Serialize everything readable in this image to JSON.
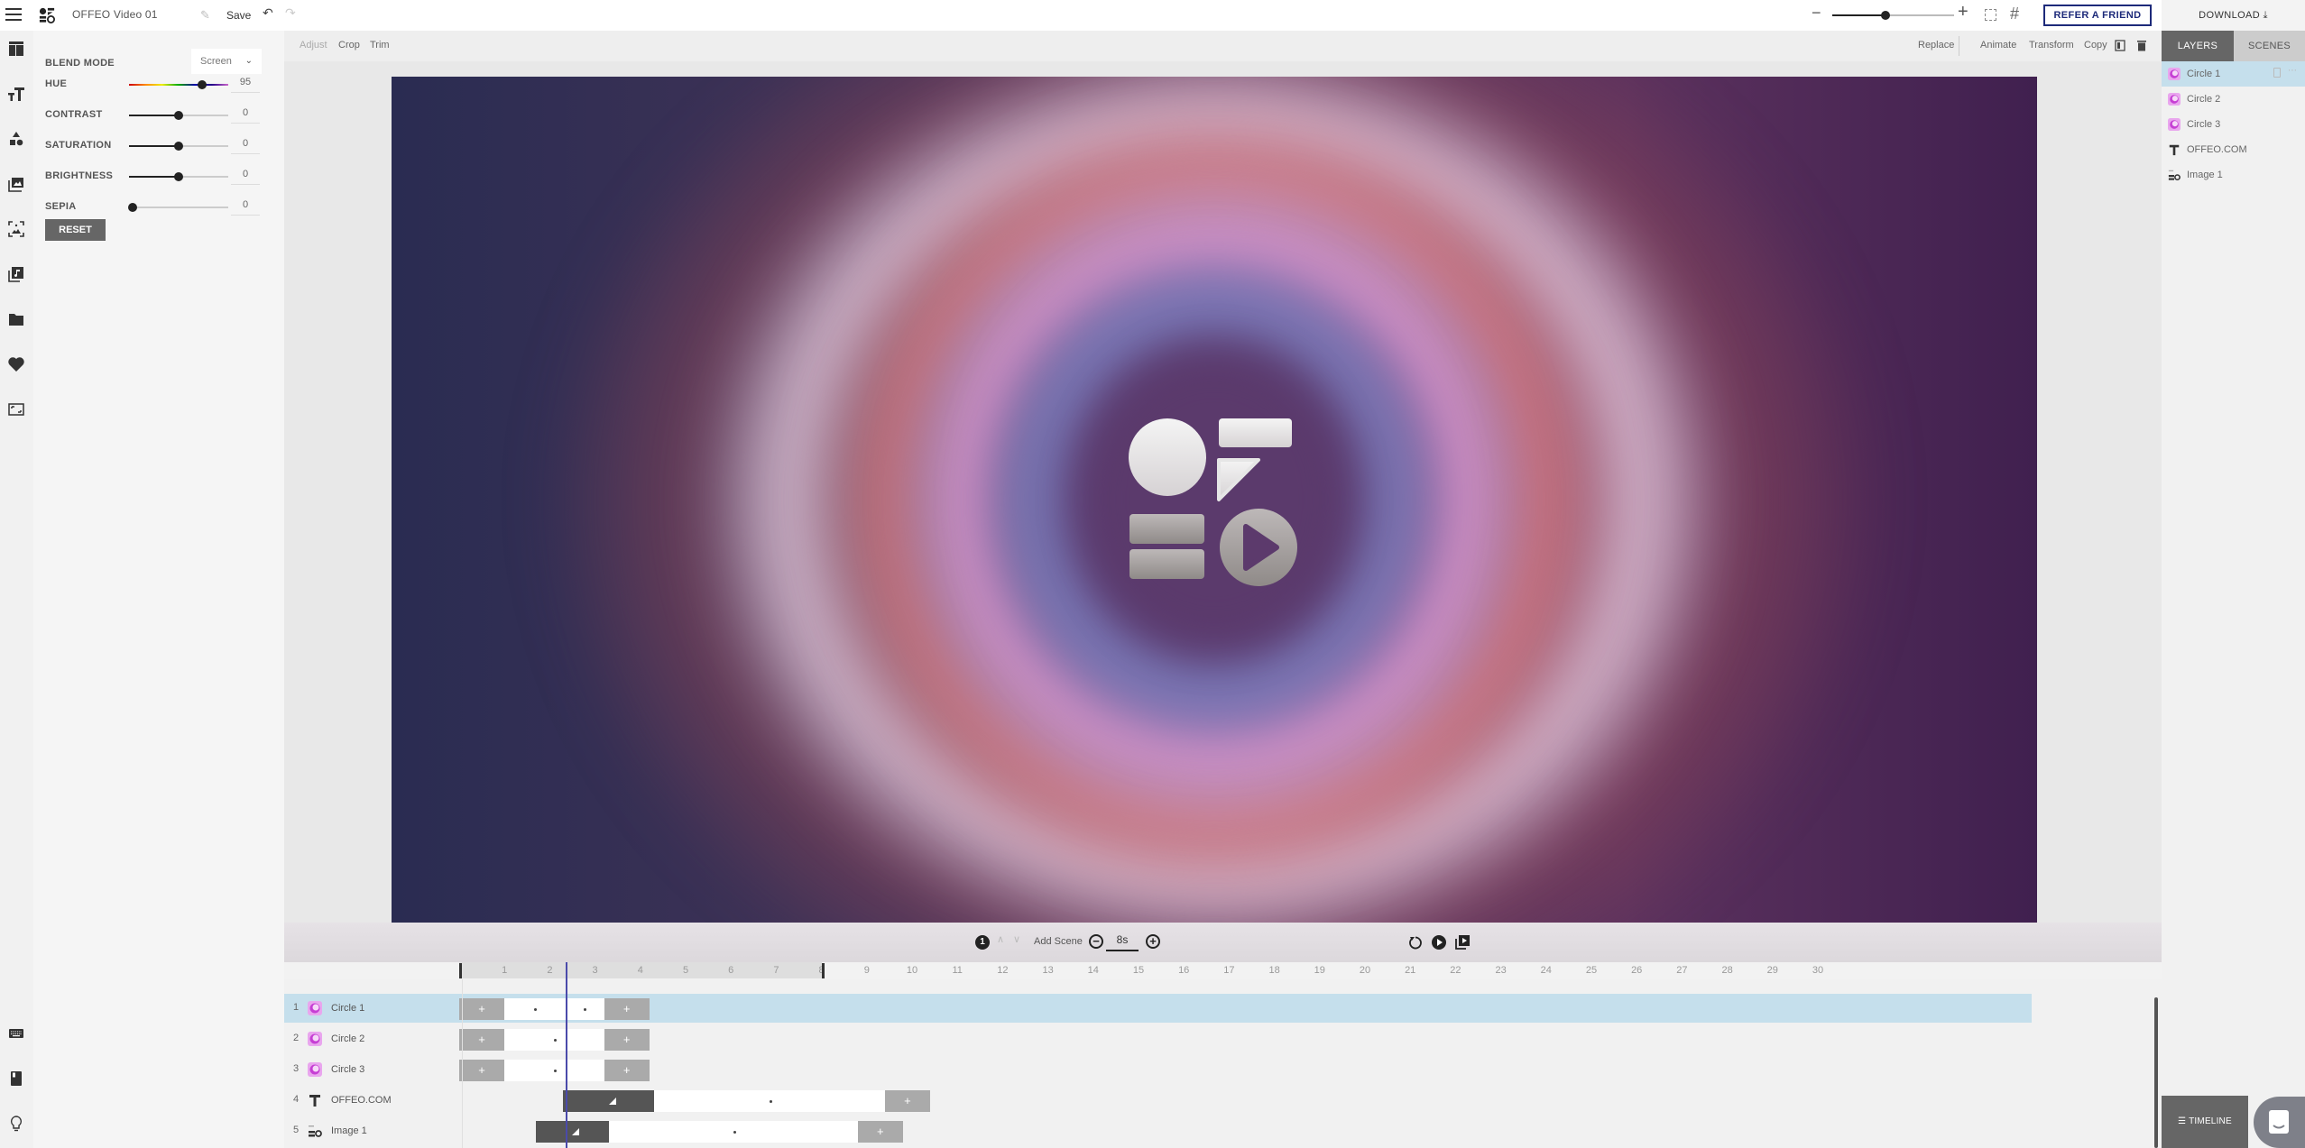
{
  "header": {
    "menu_icon": "hamburger-icon",
    "logo_icon": "offeo-logo-icon",
    "title": "OFFEO Video 01",
    "rename_icon": "pencil-icon",
    "save_label": "Save",
    "undo_icon": "undo-icon",
    "redo_icon": "redo-icon",
    "zoom_minus": "−",
    "zoom_plus": "+",
    "zoom_level_fraction": 0.44,
    "fit_icon": "fit-screen-icon",
    "grid_icon": "grid-icon",
    "grid_glyph": "#",
    "refer_label": "REFER A FRIEND",
    "download_label": "DOWNLOAD ⤓"
  },
  "rail": {
    "items": [
      {
        "name": "templates-icon"
      },
      {
        "name": "text-icon"
      },
      {
        "name": "shapes-icon"
      },
      {
        "name": "images-icon"
      },
      {
        "name": "backgrounds-icon"
      },
      {
        "name": "music-icon"
      },
      {
        "name": "folder-icon"
      },
      {
        "name": "favorites-icon"
      },
      {
        "name": "resize-icon"
      }
    ],
    "bottom_items": [
      {
        "name": "keyboard-icon"
      },
      {
        "name": "guide-icon"
      },
      {
        "name": "lightbulb-icon"
      }
    ]
  },
  "properties": {
    "blend_mode_label": "BLEND MODE",
    "blend_mode_value": "Screen",
    "blend_chevron": "⌄",
    "adjustments": [
      {
        "label": "HUE",
        "value": "95",
        "fraction": 0.74
      },
      {
        "label": "CONTRAST",
        "value": "0",
        "fraction": 0.5
      },
      {
        "label": "SATURATION",
        "value": "0",
        "fraction": 0.5
      },
      {
        "label": "BRIGHTNESS",
        "value": "0",
        "fraction": 0.5
      },
      {
        "label": "SEPIA",
        "value": "0",
        "fraction": 0.04
      }
    ],
    "reset_label": "RESET"
  },
  "canvas_toolbar": {
    "left": [
      "Adjust",
      "Crop",
      "Trim"
    ],
    "right": [
      "Replace",
      "Animate",
      "Transform",
      "Copy"
    ],
    "layer_order_icon": "layer-order-icon",
    "delete_icon": "trash-icon"
  },
  "scene_bar": {
    "scene_number": "1",
    "up_arrow": "∧",
    "down_arrow": "∨",
    "add_scene_label": "Add Scene",
    "decrease": "−",
    "increase": "+",
    "duration": "8s",
    "replay_icon": "replay-icon",
    "play_icon": "play-icon",
    "preview_icon": "preview-icon"
  },
  "timeline": {
    "ruler_ticks": [
      "1",
      "2",
      "3",
      "4",
      "5",
      "6",
      "7",
      "8",
      "9",
      "10",
      "11",
      "12",
      "13",
      "14",
      "15",
      "16",
      "17",
      "18",
      "19",
      "20",
      "21",
      "22",
      "23",
      "24",
      "25",
      "26",
      "27",
      "28",
      "29",
      "30"
    ],
    "scene_duration_s": 8,
    "playhead_s": 2.35,
    "rows": [
      {
        "num": "1",
        "name": "Circle 1",
        "icon": "circle-layer-icon",
        "selected": true,
        "segments": [
          {
            "type": "anim",
            "start": 0.0,
            "end": 1.0,
            "label": "+"
          },
          {
            "type": "body",
            "start": 1.0,
            "end": 2.3
          },
          {
            "type": "body",
            "start": 2.3,
            "end": 3.2
          },
          {
            "type": "anim",
            "start": 3.2,
            "end": 4.2,
            "label": "+"
          }
        ]
      },
      {
        "num": "2",
        "name": "Circle 2",
        "icon": "circle-layer-icon",
        "selected": false,
        "segments": [
          {
            "type": "anim",
            "start": 0.0,
            "end": 1.0,
            "label": "+"
          },
          {
            "type": "body",
            "start": 1.0,
            "end": 3.2
          },
          {
            "type": "anim",
            "start": 3.2,
            "end": 4.2,
            "label": "+"
          }
        ]
      },
      {
        "num": "3",
        "name": "Circle 3",
        "icon": "circle-layer-icon",
        "selected": false,
        "segments": [
          {
            "type": "anim",
            "start": 0.0,
            "end": 1.0,
            "label": "+"
          },
          {
            "type": "body",
            "start": 1.0,
            "end": 3.2
          },
          {
            "type": "anim",
            "start": 3.2,
            "end": 4.2,
            "label": "+"
          }
        ]
      },
      {
        "num": "4",
        "name": "OFFEO.COM",
        "icon": "text-layer-icon",
        "selected": false,
        "segments": [
          {
            "type": "dark",
            "start": 2.3,
            "end": 4.3
          },
          {
            "type": "body",
            "start": 4.3,
            "end": 9.4
          },
          {
            "type": "anim",
            "start": 9.4,
            "end": 10.4,
            "label": "+"
          }
        ]
      },
      {
        "num": "5",
        "name": "Image 1",
        "icon": "image-layer-icon",
        "selected": false,
        "segments": [
          {
            "type": "dark",
            "start": 1.7,
            "end": 3.3
          },
          {
            "type": "body",
            "start": 3.3,
            "end": 8.8
          },
          {
            "type": "anim",
            "start": 8.8,
            "end": 9.8,
            "label": "+"
          }
        ]
      }
    ]
  },
  "right_panel": {
    "tabs": [
      {
        "label": "LAYERS",
        "active": true
      },
      {
        "label": "SCENES",
        "active": false
      }
    ],
    "layers": [
      {
        "name": "Circle 1",
        "icon": "circle-layer-icon",
        "selected": true
      },
      {
        "name": "Circle 2",
        "icon": "circle-layer-icon",
        "selected": false
      },
      {
        "name": "Circle 3",
        "icon": "circle-layer-icon",
        "selected": false
      },
      {
        "name": "OFFEO.COM",
        "icon": "text-layer-icon",
        "selected": false
      },
      {
        "name": "Image 1",
        "icon": "image-layer-icon",
        "selected": false
      }
    ],
    "more_glyph": "⋯",
    "timeline_label": "TIMELINE",
    "timeline_icon": "timeline-icon",
    "chat_icon": "chat-icon"
  },
  "colors": {
    "accent": "#1d2a7a",
    "selection": "#c5dfec",
    "playhead": "#4a4aaa",
    "button_dark": "#666666"
  }
}
